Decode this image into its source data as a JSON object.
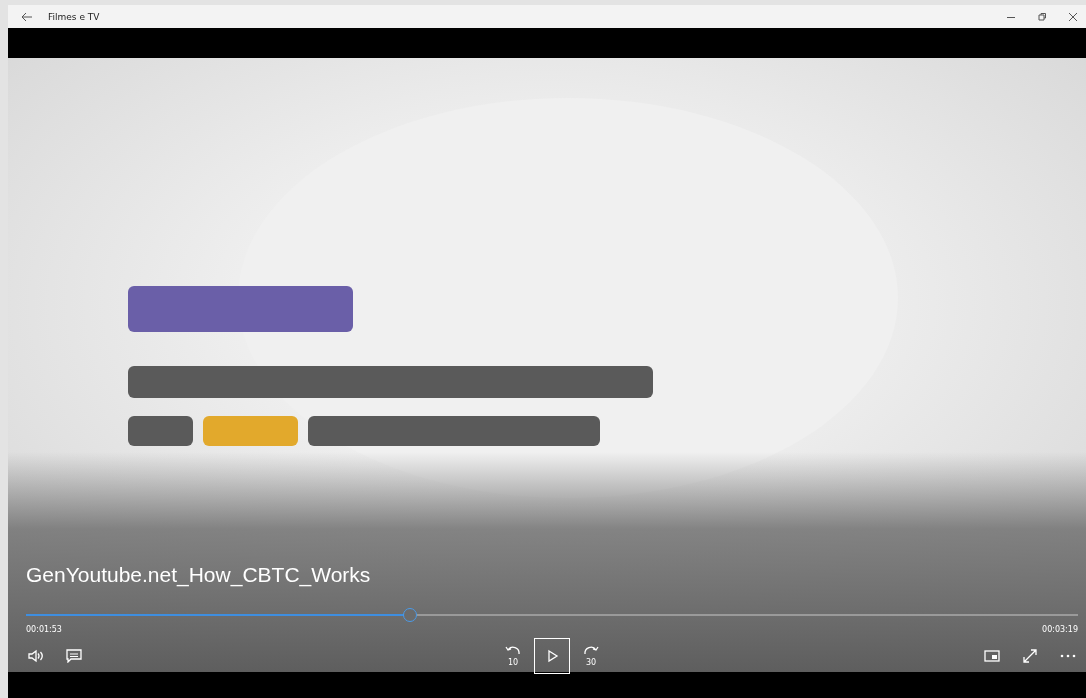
{
  "window": {
    "title": "Filmes e TV"
  },
  "player": {
    "media_title": "GenYoutube.net_How_CBTC_Works",
    "progress": {
      "level": 0.365
    },
    "elapsed": "00:01:53",
    "duration": "00:03:19",
    "skip_back": "10",
    "skip_forward": "30",
    "playing": false
  }
}
